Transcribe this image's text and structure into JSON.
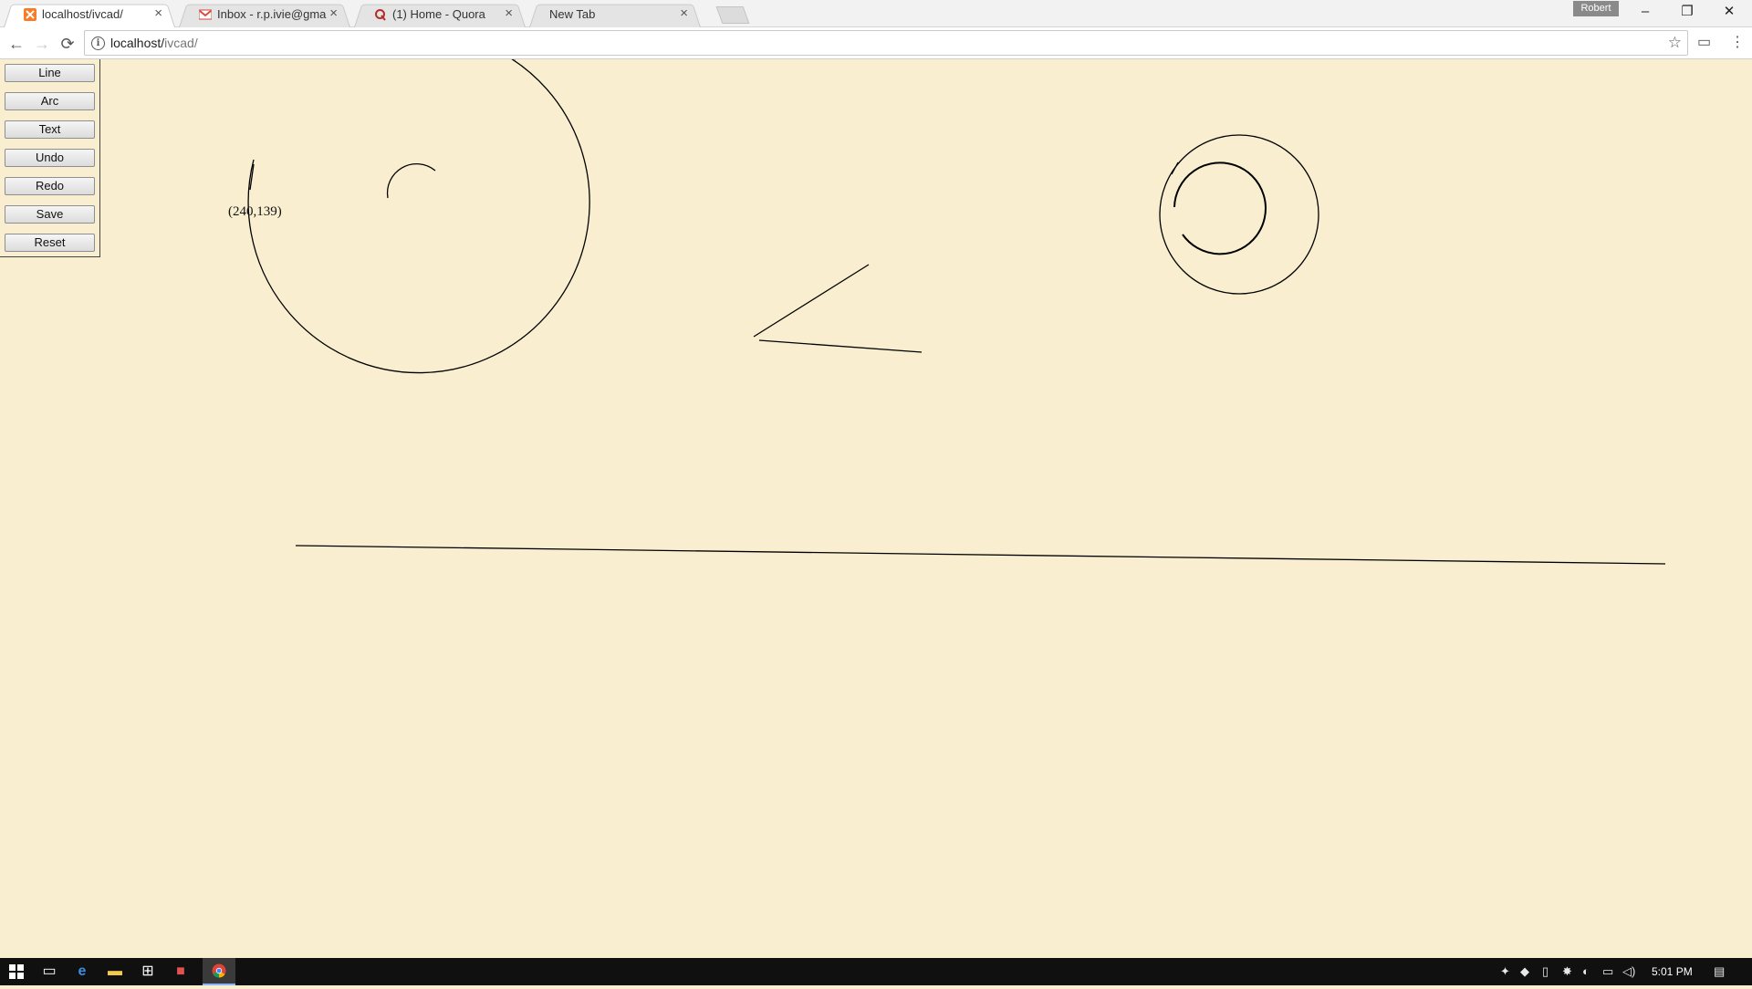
{
  "tabs": [
    {
      "title": "localhost/ivcad/",
      "icon": "xampp-icon",
      "active": true
    },
    {
      "title": "Inbox - r.p.ivie@gmail.co",
      "icon": "gmail-icon",
      "active": false
    },
    {
      "title": "(1) Home - Quora",
      "icon": "quora-icon",
      "active": false
    },
    {
      "title": "New Tab",
      "icon": "",
      "active": false
    }
  ],
  "profile": {
    "name": "Robert"
  },
  "window_controls": {
    "minimize": "–",
    "restore": "❐",
    "close": "✕"
  },
  "toolbar": {
    "back": "←",
    "forward": "→",
    "reload": "⟳",
    "info": "i",
    "star": "☆",
    "cast": "▭",
    "menu": "⋮"
  },
  "address": {
    "host": "localhost/",
    "path": "ivcad/"
  },
  "tools": [
    "Line",
    "Arc",
    "Text",
    "Undo",
    "Redo",
    "Save",
    "Reset"
  ],
  "canvas": {
    "coord_label": "(240,139)",
    "stroke_color": "#000000",
    "background": "#f9efd0"
  },
  "taskbar": {
    "clock": "5:01 PM",
    "apps": [
      "start-icon",
      "task-view-icon",
      "edge-icon",
      "file-explorer-icon",
      "store-icon",
      "app-icon",
      "chrome-icon"
    ]
  }
}
